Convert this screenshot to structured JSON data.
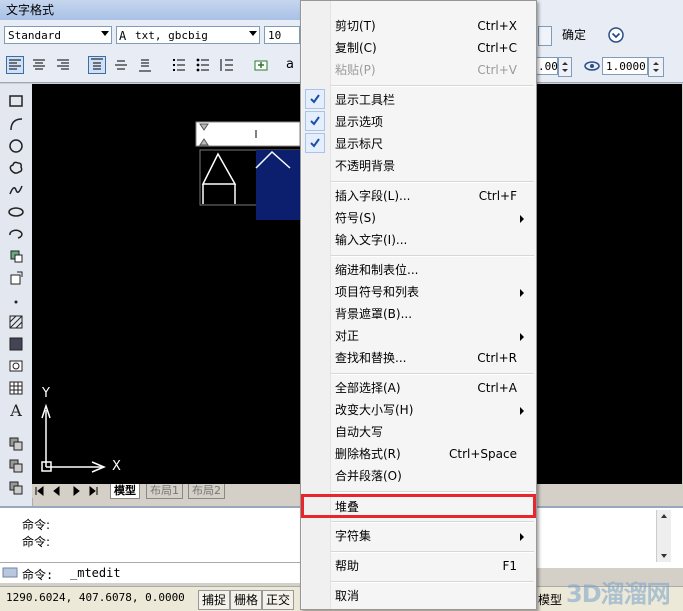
{
  "window_title": "文字格式",
  "toolbar": {
    "style_value": "Standard",
    "font_value": "txt, gbcbig",
    "height_value": "10",
    "ok_label": "确定",
    "angle_value": ".00",
    "tracking_value": "1.0000",
    "partial_letter": "a"
  },
  "layout_tabs": [
    "模型",
    "布局1",
    "布局2"
  ],
  "axes": {
    "y_label": "Y",
    "x_label": "X"
  },
  "command": {
    "lines": [
      "命令:",
      "命令:"
    ],
    "prompt": "命令:",
    "current": "_mtedit"
  },
  "status": {
    "coords": "1290.6024, 407.6078, 0.0000",
    "buttons": [
      "捕捉",
      "栅格",
      "正交"
    ],
    "right_label": "模型"
  },
  "context_menu": {
    "items": [
      {
        "label": "剪切(T)",
        "shortcut": "Ctrl+X",
        "disabled": false
      },
      {
        "label": "复制(C)",
        "shortcut": "Ctrl+C",
        "disabled": false
      },
      {
        "label": "粘贴(P)",
        "shortcut": "Ctrl+V",
        "disabled": true
      },
      {
        "label": "显示工具栏",
        "checked": true
      },
      {
        "label": "显示选项",
        "checked": true
      },
      {
        "label": "显示标尺",
        "checked": true
      },
      {
        "label": "不透明背景",
        "checked": false
      },
      {
        "label": "插入字段(L)...",
        "shortcut": "Ctrl+F"
      },
      {
        "label": "符号(S)",
        "submenu": true
      },
      {
        "label": "输入文字(I)..."
      },
      {
        "label": "缩进和制表位..."
      },
      {
        "label": "项目符号和列表",
        "submenu": true
      },
      {
        "label": "背景遮罩(B)..."
      },
      {
        "label": "对正",
        "submenu": true
      },
      {
        "label": "查找和替换...",
        "shortcut": "Ctrl+R"
      },
      {
        "label": "全部选择(A)",
        "shortcut": "Ctrl+A"
      },
      {
        "label": "改变大小写(H)",
        "submenu": true
      },
      {
        "label": "自动大写"
      },
      {
        "label": "删除格式(R)",
        "shortcut": "Ctrl+Space"
      },
      {
        "label": "合并段落(O)"
      },
      {
        "label": "堆叠"
      },
      {
        "label": "字符集",
        "submenu": true
      },
      {
        "label": "帮助",
        "shortcut": "F1"
      },
      {
        "label": "取消"
      }
    ]
  },
  "watermark": "3D溜溜网"
}
